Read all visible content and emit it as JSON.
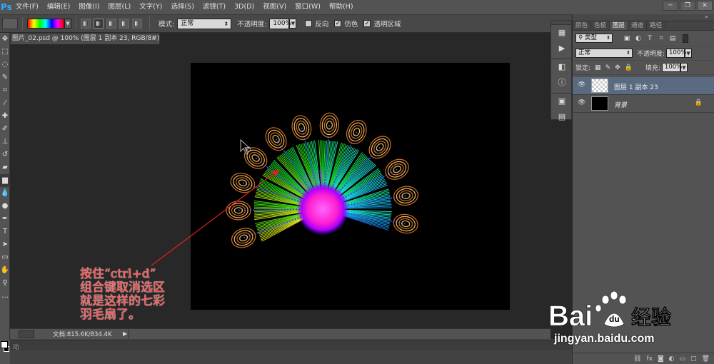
{
  "menubar": {
    "logo": "Ps",
    "items": [
      "文件(F)",
      "编辑(E)",
      "图像(I)",
      "图层(L)",
      "文字(Y)",
      "选择(S)",
      "滤镜(T)",
      "3D(D)",
      "视图(V)",
      "窗口(W)",
      "帮助(H)"
    ]
  },
  "window_controls": {
    "minimize": "─",
    "restore": "❐",
    "close": "✕"
  },
  "options": {
    "mode_label": "模式:",
    "mode_value": "正常",
    "opacity_label": "不透明度:",
    "opacity_value": "100%",
    "reverse_label": "反向",
    "reverse_checked": false,
    "dither_label": "仿色",
    "dither_checked": true,
    "transparency_label": "透明区域",
    "transparency_checked": true
  },
  "document": {
    "tab_title": "图片_02.psd @ 100% (图层 1 副本 23, RGB/8#) *",
    "close": "×"
  },
  "status": {
    "doc_info": "文档:815.6K/834.4K",
    "bottom_tag": "动"
  },
  "layers_panel": {
    "tabs": [
      "颜色",
      "色板",
      "图层",
      "通道",
      "路径"
    ],
    "active_tab": 2,
    "filter_label": "类型",
    "blend_mode": "正常",
    "opacity_label": "不透明度:",
    "opacity_value": "100%",
    "lock_label": "锁定:",
    "fill_label": "填充:",
    "fill_value": "100%",
    "layers": [
      {
        "name": "图层 1 副本 23",
        "selected": true,
        "visible": true
      },
      {
        "name": "背景",
        "selected": false,
        "visible": true,
        "locked": true
      }
    ]
  },
  "annotation": {
    "lines": [
      "按住“ctrl+d”",
      "组合键取消选区",
      "就是这样的七彩",
      "羽毛扇了。"
    ],
    "color": "#ff4a4a"
  },
  "watermark": {
    "brand": "Bai",
    "suffix": "经验",
    "url": "jingyan.baidu.com"
  }
}
